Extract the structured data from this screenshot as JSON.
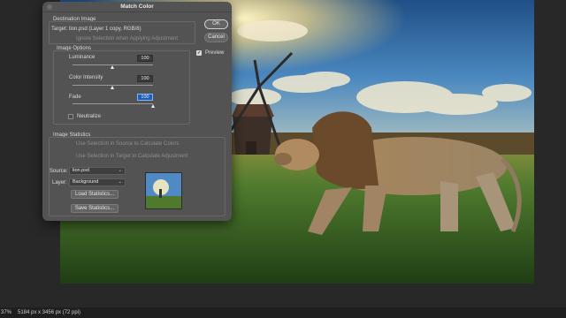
{
  "dialog": {
    "title": "Match Color",
    "destination": {
      "legend": "Destination Image",
      "target_label": "Target:",
      "target_value": "lion.psd (Layer 1 copy, RGB/8)",
      "ignore_selection": "Ignore Selection when Applying Adjustment"
    },
    "image_options": {
      "legend": "Image Options",
      "luminance": {
        "label": "Luminance",
        "value": "100",
        "level": 100,
        "max": 200
      },
      "color_intensity": {
        "label": "Color Intensity",
        "value": "100",
        "level": 100,
        "max": 200
      },
      "fade": {
        "label": "Fade",
        "value": "100",
        "level": 100,
        "max": 100
      },
      "neutralize": {
        "label": "Neutralize",
        "checked": false
      }
    },
    "image_statistics": {
      "legend": "Image Statistics",
      "use_selection_source": "Use Selection in Source to Calculate Colors",
      "use_selection_target": "Use Selection in Target to Calculate Adjustment",
      "source_label": "Source:",
      "source_value": "lion.psd",
      "layer_label": "Layer:",
      "layer_value": "Background",
      "load_button": "Load Statistics...",
      "save_button": "Save Statistics..."
    },
    "ok_button": "OK",
    "cancel_button": "Cancel",
    "preview": {
      "label": "Preview",
      "checked": true
    }
  },
  "status_bar": {
    "zoom": "37%",
    "dimensions": "5184 px x 3456 px (72 ppi)"
  },
  "colors": {
    "dialog_bg": "#535353",
    "accent": "#1d5fb6",
    "sky": "#3f7fb8",
    "grass": "#3d6a2a"
  }
}
